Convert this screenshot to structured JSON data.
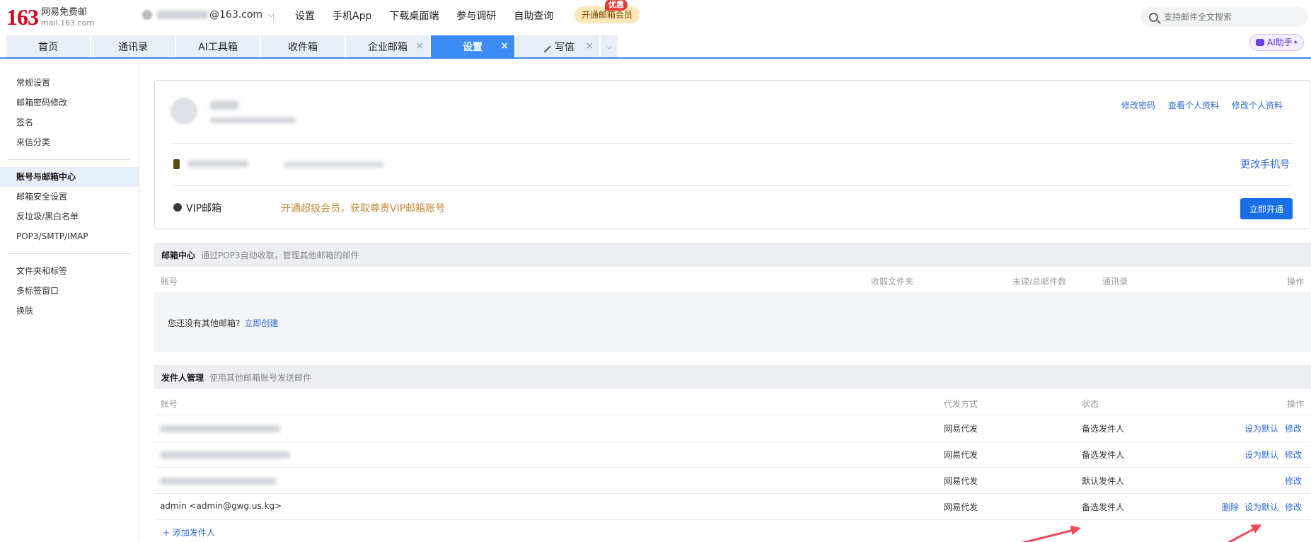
{
  "brand": {
    "number": "163",
    "name": "网易免费邮",
    "domain": "mail.163.com"
  },
  "account": {
    "email_visible": "@163.com"
  },
  "top_nav": [
    "设置",
    "手机App",
    "下载桌面端",
    "参与调研",
    "自助查询"
  ],
  "vip": {
    "label": "开通邮箱会员",
    "badge": "优惠"
  },
  "search": {
    "placeholder": "支持邮件全文搜索"
  },
  "ai_button": "AI助手",
  "tabs": [
    {
      "label": "首页"
    },
    {
      "label": "通讯录"
    },
    {
      "label": "AI工具箱"
    },
    {
      "label": "收件箱"
    },
    {
      "label": "企业邮箱",
      "close": "×"
    },
    {
      "label": "设置",
      "close": "×"
    },
    {
      "label": "写信",
      "close": "×"
    }
  ],
  "sidebar": {
    "group1": [
      "常规设置",
      "邮箱密码修改",
      "签名",
      "来信分类"
    ],
    "group2": [
      "账号与邮箱中心",
      "邮箱安全设置",
      "反垃圾/黑白名单",
      "POP3/SMTP/IMAP"
    ],
    "group3": [
      "文件夹和标签",
      "多标签窗口",
      "换肤"
    ]
  },
  "profile": {
    "links": [
      "修改密码",
      "查看个人资料",
      "修改个人资料"
    ],
    "change_phone": "更改手机号",
    "vip_label": "VIP邮箱",
    "vip_promo": "开通超级会员，获取尊贵VIP邮箱账号",
    "open_button": "立即开通"
  },
  "mailbox_center": {
    "title": "邮箱中心",
    "desc": "通过POP3自动收取，管理其他邮箱的邮件",
    "columns": [
      "账号",
      "收取文件夹",
      "未读/总邮件数",
      "通讯录",
      "操作"
    ],
    "empty_text": "您还没有其他邮箱?",
    "create_link": "立即创建"
  },
  "sender_mgmt": {
    "title": "发件人管理",
    "desc": "使用其他邮箱账号发送邮件",
    "columns": [
      "账号",
      "代发方式",
      "状态",
      "操作"
    ],
    "rows": [
      {
        "account": "",
        "method": "网易代发",
        "status": "备选发件人",
        "ops": [
          "设为默认",
          "修改"
        ]
      },
      {
        "account": "",
        "method": "网易代发",
        "status": "备选发件人",
        "ops": [
          "设为默认",
          "修改"
        ]
      },
      {
        "account": "",
        "method": "网易代发",
        "status": "默认发件人",
        "ops": [
          "修改"
        ]
      },
      {
        "account": "admin <admin@gwg.us.kg>",
        "method": "网易代发",
        "status": "备选发件人",
        "ops": [
          "删除",
          "设为默认",
          "修改"
        ]
      }
    ],
    "add_sender": "+ 添加发件人"
  },
  "colors": {
    "accent": "#3d8cf5",
    "link": "#2d6ad6",
    "brand_red": "#d0021b",
    "arrow": "#f04a5a"
  }
}
